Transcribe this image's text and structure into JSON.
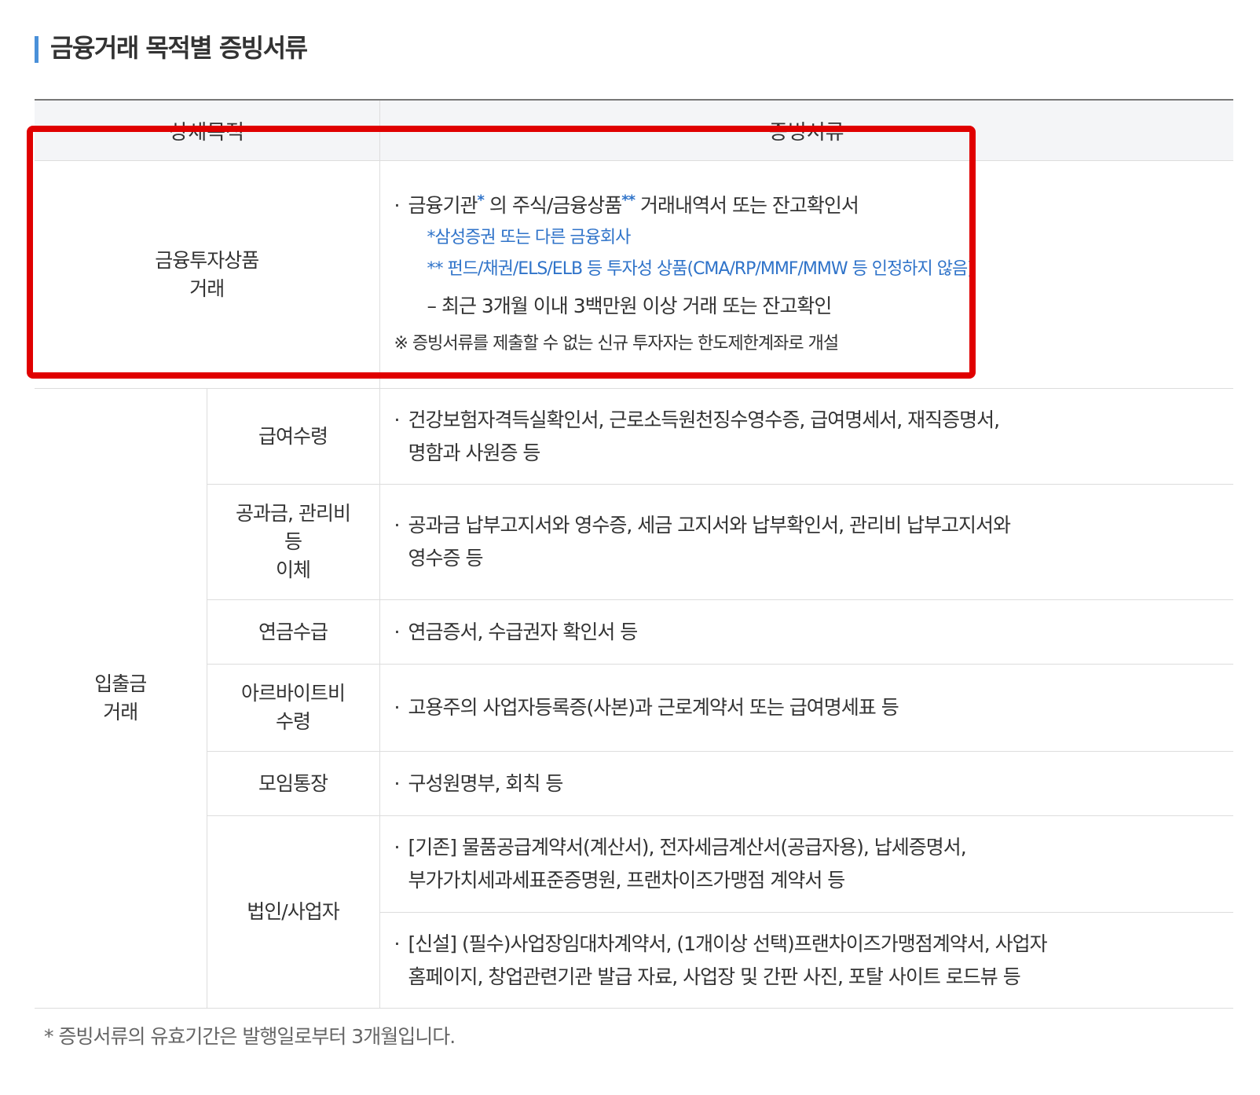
{
  "title": "금융거래 목적별 증빙서류",
  "table": {
    "headers": {
      "purpose": "상세목적",
      "documents": "증빙서류"
    },
    "investment": {
      "category_line1": "금융투자상품",
      "category_line2": "거래",
      "main_prefix": "금융기관",
      "main_mid": " 의 주식/금융상품",
      "main_suffix": " 거래내역서 또는 잔고확인서",
      "star1": "*",
      "star2": "**",
      "note1": "*삼성증권 또는 다른 금융회사",
      "note2": "** 펀드/채권/ELS/ELB 등 투자성 상품(CMA/RP/MMF/MMW 등 인정하지 않음)",
      "condition": "–  최근 3개월 이내 3백만원 이상 거래 또는 잔고확인",
      "reference": "※  증빙서류를 제출할 수 없는 신규 투자자는 한도제한계좌로 개설"
    },
    "deposit": {
      "category_line1": "입출금",
      "category_line2": "거래",
      "rows": [
        {
          "sub": [
            "급여수령"
          ],
          "docs": [
            "건강보험자격득실확인서, 근로소득원천징수영수증, 급여명세서, 재직증명서,",
            "명함과 사원증 등"
          ]
        },
        {
          "sub": [
            "공과금, 관리비",
            "등",
            "이체"
          ],
          "docs": [
            "공과금 납부고지서와 영수증, 세금 고지서와 납부확인서, 관리비 납부고지서와",
            "영수증 등"
          ]
        },
        {
          "sub": [
            "연금수급"
          ],
          "docs": [
            "연금증서, 수급권자 확인서 등"
          ]
        },
        {
          "sub": [
            "아르바이트비",
            "수령"
          ],
          "docs": [
            "고용주의 사업자등록증(사본)과 근로계약서 또는 급여명세표 등"
          ]
        },
        {
          "sub": [
            "모임통장"
          ],
          "docs": [
            "구성원명부, 회칙 등"
          ]
        }
      ],
      "business": {
        "sub": "법인/사업자",
        "existing": [
          "[기존] 물품공급계약서(계산서), 전자세금계산서(공급자용), 납세증명서,",
          "부가가치세과세표준증명원, 프랜차이즈가맹점 계약서 등"
        ],
        "new": [
          "[신설] (필수)사업장임대차계약서, (1개이상 선택)프랜차이즈가맹점계약서, 사업자",
          "홈페이지, 창업관련기관 발급 자료, 사업장 및 간판 사진, 포탈 사이트 로드뷰 등"
        ]
      }
    }
  },
  "bullet": "·",
  "footnote": "* 증빙서류의 유효기간은 발행일로부터 3개월입니다.",
  "colors": {
    "accent": "#4a90d9",
    "note": "#2f73c9",
    "highlight": "#e00000"
  }
}
